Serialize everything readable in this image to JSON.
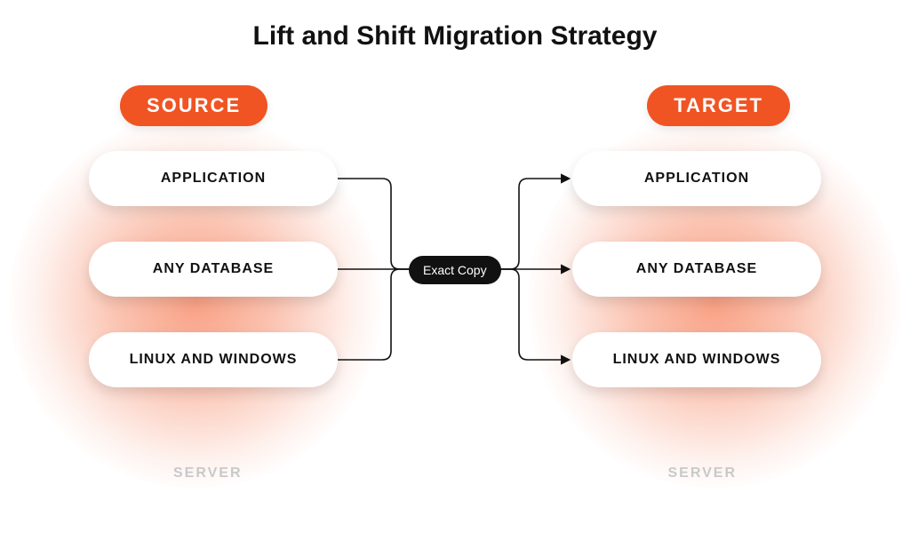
{
  "title": "Lift and Shift Migration Strategy",
  "source": {
    "badge": "SOURCE",
    "items": [
      "APPLICATION",
      "ANY DATABASE",
      "LINUX AND WINDOWS"
    ],
    "footer": "SERVER"
  },
  "target": {
    "badge": "TARGET",
    "items": [
      "APPLICATION",
      "ANY DATABASE",
      "LINUX AND WINDOWS"
    ],
    "footer": "SERVER"
  },
  "center_label": "Exact Copy",
  "colors": {
    "accent": "#f05423",
    "center_badge_bg": "#111111"
  }
}
